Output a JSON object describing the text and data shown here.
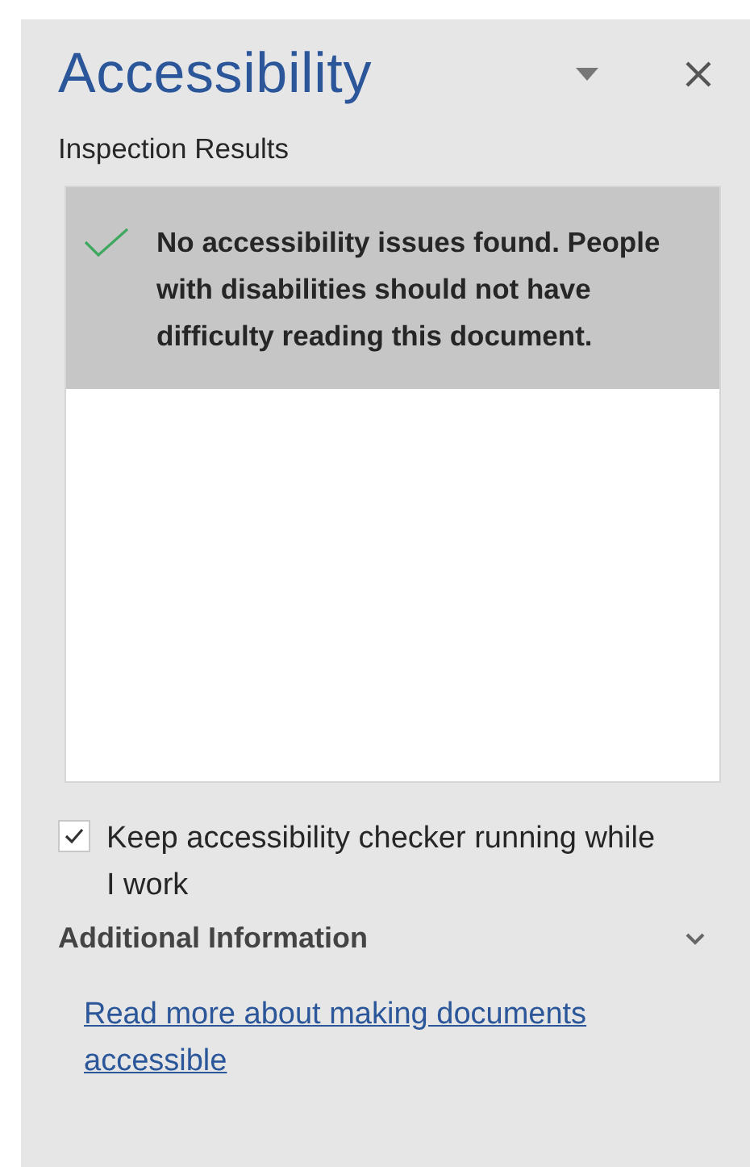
{
  "pane": {
    "title": "Accessibility"
  },
  "results": {
    "label": "Inspection Results",
    "items": [
      {
        "kind": "success",
        "text": "No accessibility issues found. People with disabilities should not have difficulty reading this document.",
        "selected": true
      }
    ]
  },
  "option": {
    "label": "Keep accessibility checker running while I work",
    "checked": true
  },
  "additional": {
    "title": "Additional Information",
    "expanded": true,
    "link": "Read more about making documents accessible"
  }
}
